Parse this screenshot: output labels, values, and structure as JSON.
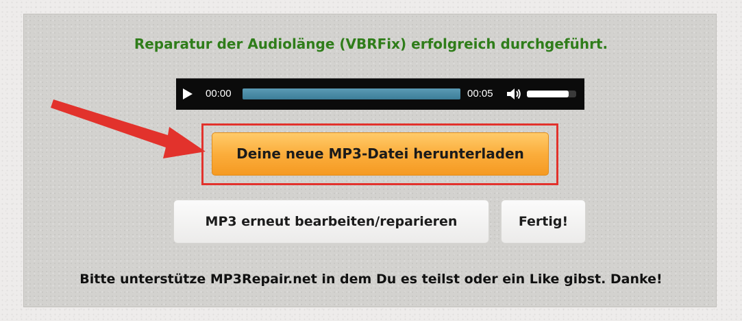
{
  "status": {
    "message": "Reparatur der Audiolänge (VBRFix) erfolgreich durchgeführt.",
    "color": "#2f7d1a"
  },
  "player": {
    "play_icon": "play-icon",
    "current_time": "00:00",
    "total_time": "00:05",
    "loaded_fraction": 1.0,
    "volume_icon": "speaker-icon",
    "volume_fraction": 0.85,
    "progress_color": "#3c7d98"
  },
  "actions": {
    "download_label": "Deine neue MP3-Datei herunterladen",
    "download_color": "#fbad3c",
    "edit_label": "MP3 erneut bearbeiten/reparieren",
    "done_label": "Fertig!"
  },
  "annotation": {
    "arrow_color": "#e2322c",
    "highlight_color": "#e2322c"
  },
  "footer": {
    "note": "Bitte unterstütze MP3Repair.net in dem Du es teilst oder ein Like gibst. Danke!"
  }
}
